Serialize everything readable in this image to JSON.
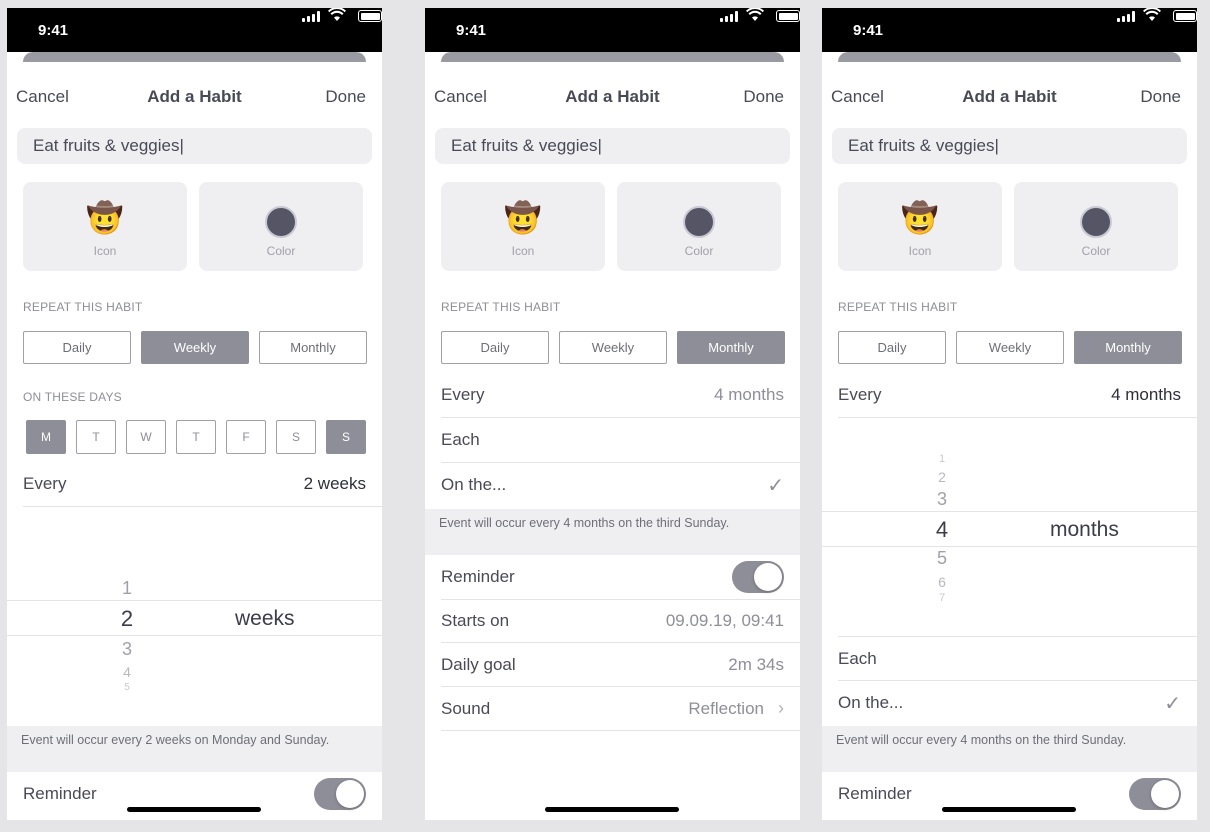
{
  "status_time": "9:41",
  "nav": {
    "cancel": "Cancel",
    "title": "Add a Habit",
    "done": "Done"
  },
  "name_value": "Eat fruits & veggies|",
  "icon_tile": {
    "emoji": "🤠",
    "label": "Icon"
  },
  "color_tile": {
    "label": "Color",
    "swatch": "#555566"
  },
  "repeat_header": "REPEAT THIS HABIT",
  "repeat_options": [
    "Daily",
    "Weekly",
    "Monthly"
  ],
  "days_header": "ON THESE DAYS",
  "days": [
    "M",
    "T",
    "W",
    "T",
    "F",
    "S",
    "S"
  ],
  "labels": {
    "every": "Every",
    "each": "Each",
    "on_the": "On the...",
    "reminder": "Reminder",
    "starts_on": "Starts on",
    "daily_goal": "Daily goal",
    "sound": "Sound"
  },
  "screens": {
    "weekly": {
      "active_option": "Weekly",
      "selected_days": [
        "M",
        "S (Sunday)"
      ],
      "every_value": "2 weeks",
      "picker": {
        "numbers": [
          "1",
          "2",
          "3",
          "4",
          "5"
        ],
        "selected": "2",
        "unit": "weeks"
      },
      "note": "Event will occur every 2 weeks on Monday and Sunday.",
      "reminder_on": true
    },
    "monthly": {
      "active_option": "Monthly",
      "every_value": "4 months",
      "note": "Event will occur every 4 months on the third Sunday.",
      "reminder_on": true,
      "starts_on_value": "09.09.19, 09:41",
      "daily_goal_value": "2m 34s",
      "sound_value": "Reflection",
      "check": "✓"
    },
    "monthly_picker": {
      "active_option": "Monthly",
      "every_value": "4 months",
      "picker": {
        "numbers": [
          "1",
          "2",
          "3",
          "4",
          "5",
          "6",
          "7"
        ],
        "selected": "4",
        "unit": "months"
      },
      "note": "Event will occur every 4 months on the third Sunday.",
      "reminder_on": true,
      "check": "✓"
    }
  },
  "colors": {
    "accent": "#8e8e98",
    "text": "#4a4a57",
    "field_bg": "#efeff2",
    "toggle_on": "#8e8e98"
  }
}
